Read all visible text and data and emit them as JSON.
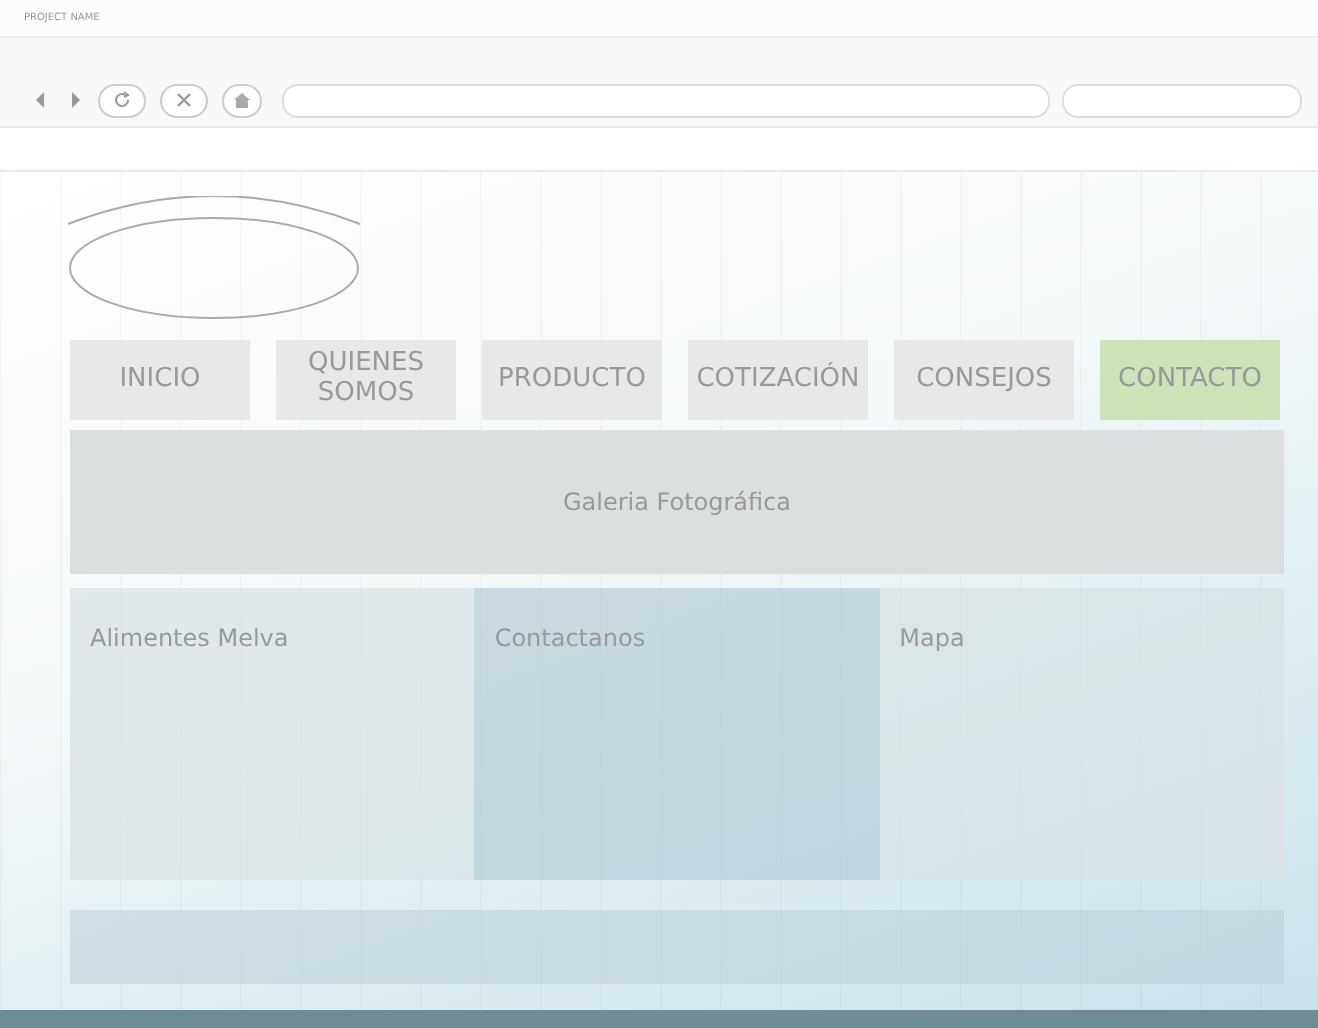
{
  "window": {
    "title": "PROJECT NAME"
  },
  "nav": [
    {
      "label": "INICIO",
      "selected": false
    },
    {
      "label": "QUIENES SOMOS",
      "selected": false
    },
    {
      "label": "PRODUCTO",
      "selected": false
    },
    {
      "label": "COTIZACIÓN",
      "selected": false
    },
    {
      "label": "CONSEJOS",
      "selected": false
    },
    {
      "label": "CONTACTO",
      "selected": true
    }
  ],
  "gallery": {
    "title": "Galeria Fotográfica"
  },
  "columns": [
    {
      "title": "Alimentes Melva"
    },
    {
      "title": "Contactanos"
    },
    {
      "title": "Mapa"
    }
  ]
}
